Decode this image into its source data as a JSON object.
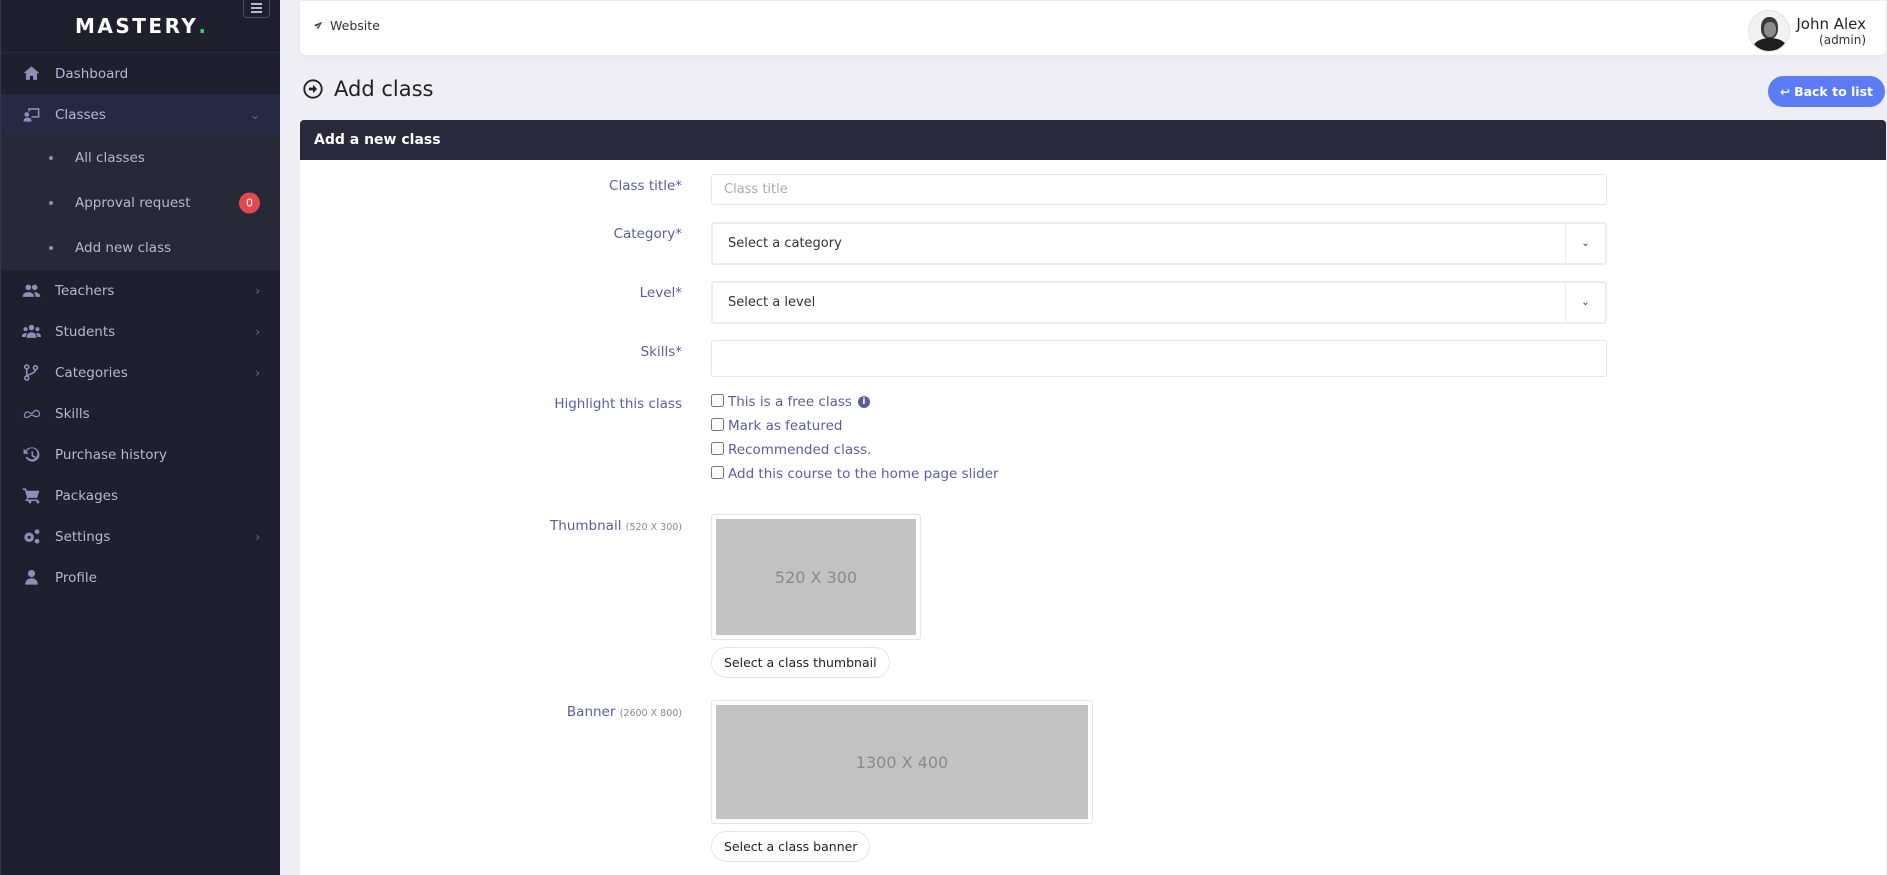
{
  "sidebar": {
    "brand": "MASTERY",
    "brand_dot": ".",
    "items": [
      {
        "label": "Dashboard",
        "icon": "home-icon"
      },
      {
        "label": "Classes",
        "icon": "classroom-icon",
        "expanded": true,
        "children": [
          {
            "label": "All classes"
          },
          {
            "label": "Approval request",
            "badge": "0"
          },
          {
            "label": "Add new class"
          }
        ]
      },
      {
        "label": "Teachers",
        "icon": "user-group-icon"
      },
      {
        "label": "Students",
        "icon": "users-icon"
      },
      {
        "label": "Categories",
        "icon": "code-branch-icon"
      },
      {
        "label": "Skills",
        "icon": "infinity-icon"
      },
      {
        "label": "Purchase history",
        "icon": "history-icon"
      },
      {
        "label": "Packages",
        "icon": "cart-icon"
      },
      {
        "label": "Settings",
        "icon": "gears-icon"
      },
      {
        "label": "Profile",
        "icon": "user-icon"
      }
    ]
  },
  "topbar": {
    "website_label": "Website",
    "user_name": "John Alex",
    "user_role": "(admin)"
  },
  "page": {
    "title": "Add class",
    "back_button": "Back to list"
  },
  "form": {
    "card_title": "Add a new class",
    "class_title": {
      "label": "Class title*",
      "placeholder": "Class title",
      "value": ""
    },
    "category": {
      "label": "Category*",
      "selected": "Select a category"
    },
    "level": {
      "label": "Level*",
      "selected": "Select a level"
    },
    "skills": {
      "label": "Skills*",
      "value": ""
    },
    "highlight": {
      "label": "Highlight this class",
      "options": [
        {
          "label": "This is a free class",
          "checked": false,
          "info": true
        },
        {
          "label": "Mark as featured",
          "checked": false
        },
        {
          "label": "Recommended class.",
          "checked": false
        },
        {
          "label": "Add this course to the home page slider",
          "checked": false
        }
      ]
    },
    "thumbnail": {
      "label": "Thumbnail",
      "hint": "(520 X 300)",
      "placeholder_text": "520 X 300",
      "button": "Select a class thumbnail"
    },
    "banner": {
      "label": "Banner",
      "hint": "(2600 X 800)",
      "placeholder_text": "1300 X 400",
      "button": "Select a class banner"
    }
  },
  "colors": {
    "sidebar_bg": "#1f202d",
    "accent": "#5b7cf5",
    "badge": "#e3484f",
    "label": "#5a5f9a",
    "card_header": "#282a3b",
    "brand_dot": "#2bd46a"
  }
}
